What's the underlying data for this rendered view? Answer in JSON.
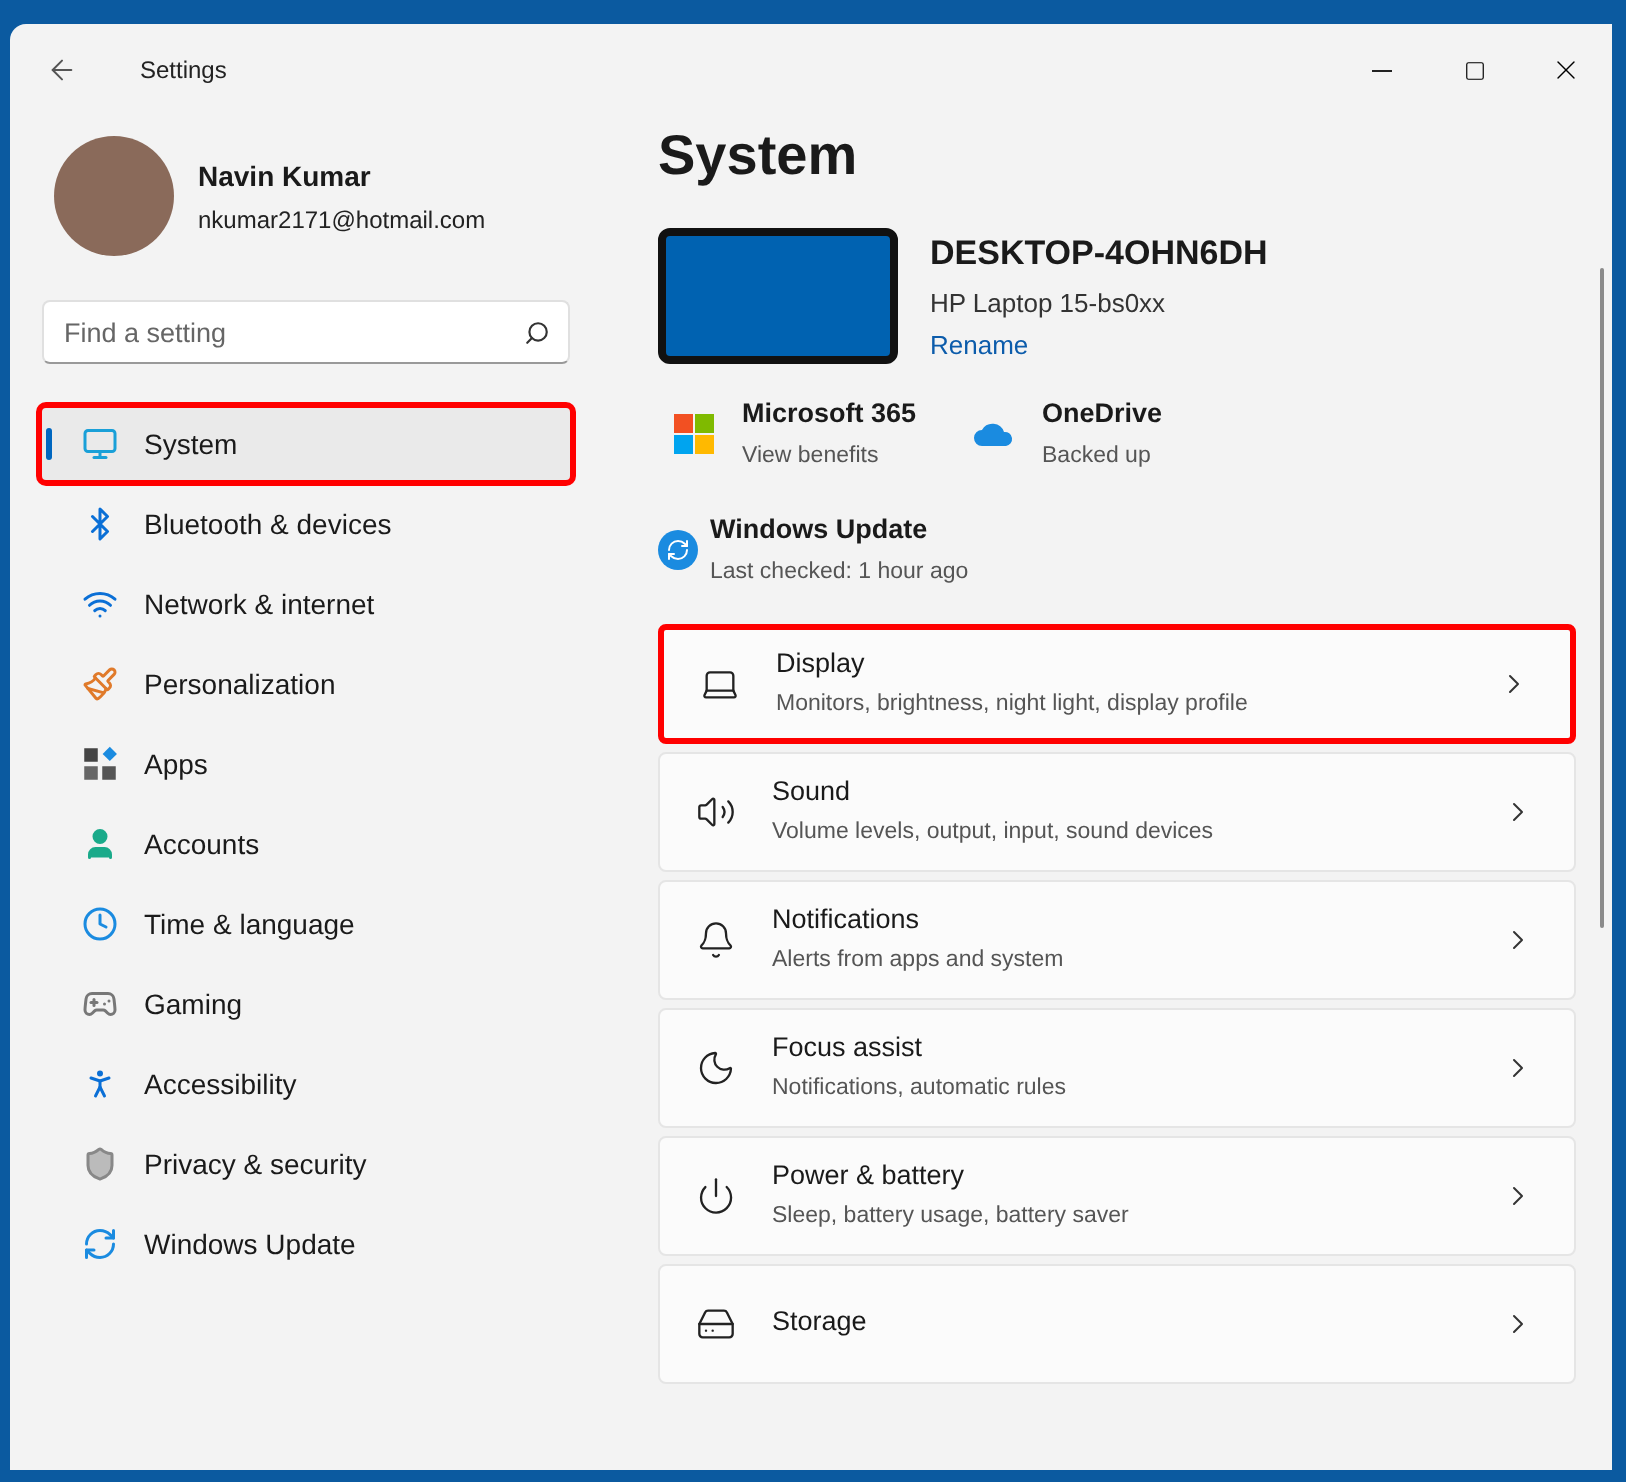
{
  "window": {
    "title": "Settings"
  },
  "profile": {
    "name": "Navin Kumar",
    "email": "nkumar2171@hotmail.com"
  },
  "search": {
    "placeholder": "Find a setting"
  },
  "sidebar": {
    "items": [
      {
        "label": "System",
        "kind": "system",
        "selected": true,
        "highlighted": true
      },
      {
        "label": "Bluetooth & devices",
        "kind": "bluetooth",
        "selected": false,
        "highlighted": false
      },
      {
        "label": "Network & internet",
        "kind": "network",
        "selected": false,
        "highlighted": false
      },
      {
        "label": "Personalization",
        "kind": "brush",
        "selected": false,
        "highlighted": false
      },
      {
        "label": "Apps",
        "kind": "apps",
        "selected": false,
        "highlighted": false
      },
      {
        "label": "Accounts",
        "kind": "accounts",
        "selected": false,
        "highlighted": false
      },
      {
        "label": "Time & language",
        "kind": "time",
        "selected": false,
        "highlighted": false
      },
      {
        "label": "Gaming",
        "kind": "gaming",
        "selected": false,
        "highlighted": false
      },
      {
        "label": "Accessibility",
        "kind": "accessibility",
        "selected": false,
        "highlighted": false
      },
      {
        "label": "Privacy & security",
        "kind": "privacy",
        "selected": false,
        "highlighted": false
      },
      {
        "label": "Windows Update",
        "kind": "update",
        "selected": false,
        "highlighted": false
      }
    ]
  },
  "page_title": "System",
  "device": {
    "name": "DESKTOP-4OHN6DH",
    "model": "HP Laptop 15-bs0xx",
    "rename_link": "Rename"
  },
  "status_tiles": [
    {
      "kind": "microsoft",
      "title": "Microsoft 365",
      "subtitle": "View benefits"
    },
    {
      "kind": "onedrive",
      "title": "OneDrive",
      "subtitle": "Backed up"
    },
    {
      "kind": "update",
      "title": "Windows Update",
      "subtitle": "Last checked: 1 hour ago"
    }
  ],
  "settings_cards": [
    {
      "kind": "display",
      "title": "Display",
      "subtitle": "Monitors, brightness, night light, display profile",
      "highlighted": true
    },
    {
      "kind": "sound",
      "title": "Sound",
      "subtitle": "Volume levels, output, input, sound devices",
      "highlighted": false
    },
    {
      "kind": "notifications",
      "title": "Notifications",
      "subtitle": "Alerts from apps and system",
      "highlighted": false
    },
    {
      "kind": "focus",
      "title": "Focus assist",
      "subtitle": "Notifications, automatic rules",
      "highlighted": false
    },
    {
      "kind": "power",
      "title": "Power & battery",
      "subtitle": "Sleep, battery usage, battery saver",
      "highlighted": false
    },
    {
      "kind": "storage",
      "title": "Storage",
      "highlighted": false
    }
  ]
}
